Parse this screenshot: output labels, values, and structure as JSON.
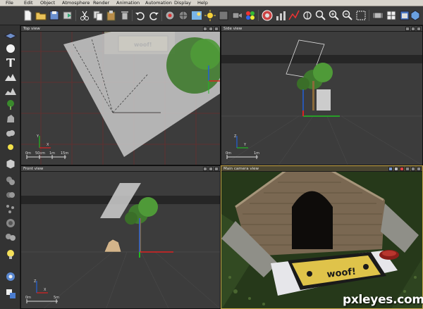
{
  "menu": [
    "File",
    "Edit",
    "Object",
    "Atmosphere",
    "Render",
    "Animation",
    "Automation",
    "Display",
    "Help"
  ],
  "toolbar": {
    "icons": [
      "new-document-icon",
      "open-folder-icon",
      "save-icon",
      "export-icon",
      "cut-icon",
      "copy-icon",
      "paste-icon",
      "delete-icon",
      "undo-icon",
      "redo-icon",
      "render-icon",
      "render-settings-icon",
      "atmosphere-icon",
      "sun-icon",
      "material-icon",
      "camera-icon",
      "color-palette-icon",
      "render-preview-icon",
      "statistics-icon",
      "graph-icon",
      "node-icon",
      "zoom-icon",
      "zoom-in-icon",
      "zoom-out-icon",
      "zoom-fit-icon",
      "film-icon",
      "layout-icon",
      "window-icon",
      "display-icon"
    ]
  },
  "left_tools": {
    "icons": [
      "plane-icon",
      "sphere-icon",
      "text-icon",
      "terrain-icon",
      "terrain-alt-icon",
      "plant-icon",
      "rock-icon",
      "cloud-icon",
      "light-icon",
      "cube-icon",
      "group-icon",
      "duplicate-icon",
      "scatter-icon",
      "boolean-icon",
      "metaball-icon",
      "bulb-icon",
      "ecosystem-icon",
      "material-swatch-icon"
    ]
  },
  "viewports": {
    "top": {
      "title": "Top view",
      "scale": [
        "0m",
        "50cm",
        "1m",
        "15m"
      ],
      "axes": [
        "Y",
        "X"
      ]
    },
    "side": {
      "title": "Side view",
      "scale": [
        "0m",
        "1m"
      ],
      "axes": [
        "Z",
        "Y"
      ]
    },
    "front": {
      "title": "Front view",
      "scale": [
        "0m",
        "5m"
      ],
      "axes": [
        "Z",
        "X"
      ]
    },
    "camera": {
      "title": "Main camera view",
      "mat_text": "woof!"
    }
  },
  "watermark": "pxleyes.com",
  "colors": {
    "menubar": "#d8d4cc",
    "toolbar": "#3a3a3a",
    "viewport_bg": "#3c3c3c",
    "grid_red": "#6a2d2d",
    "axis_x": "#d22",
    "axis_y": "#2b2",
    "axis_z": "#2360d8"
  }
}
